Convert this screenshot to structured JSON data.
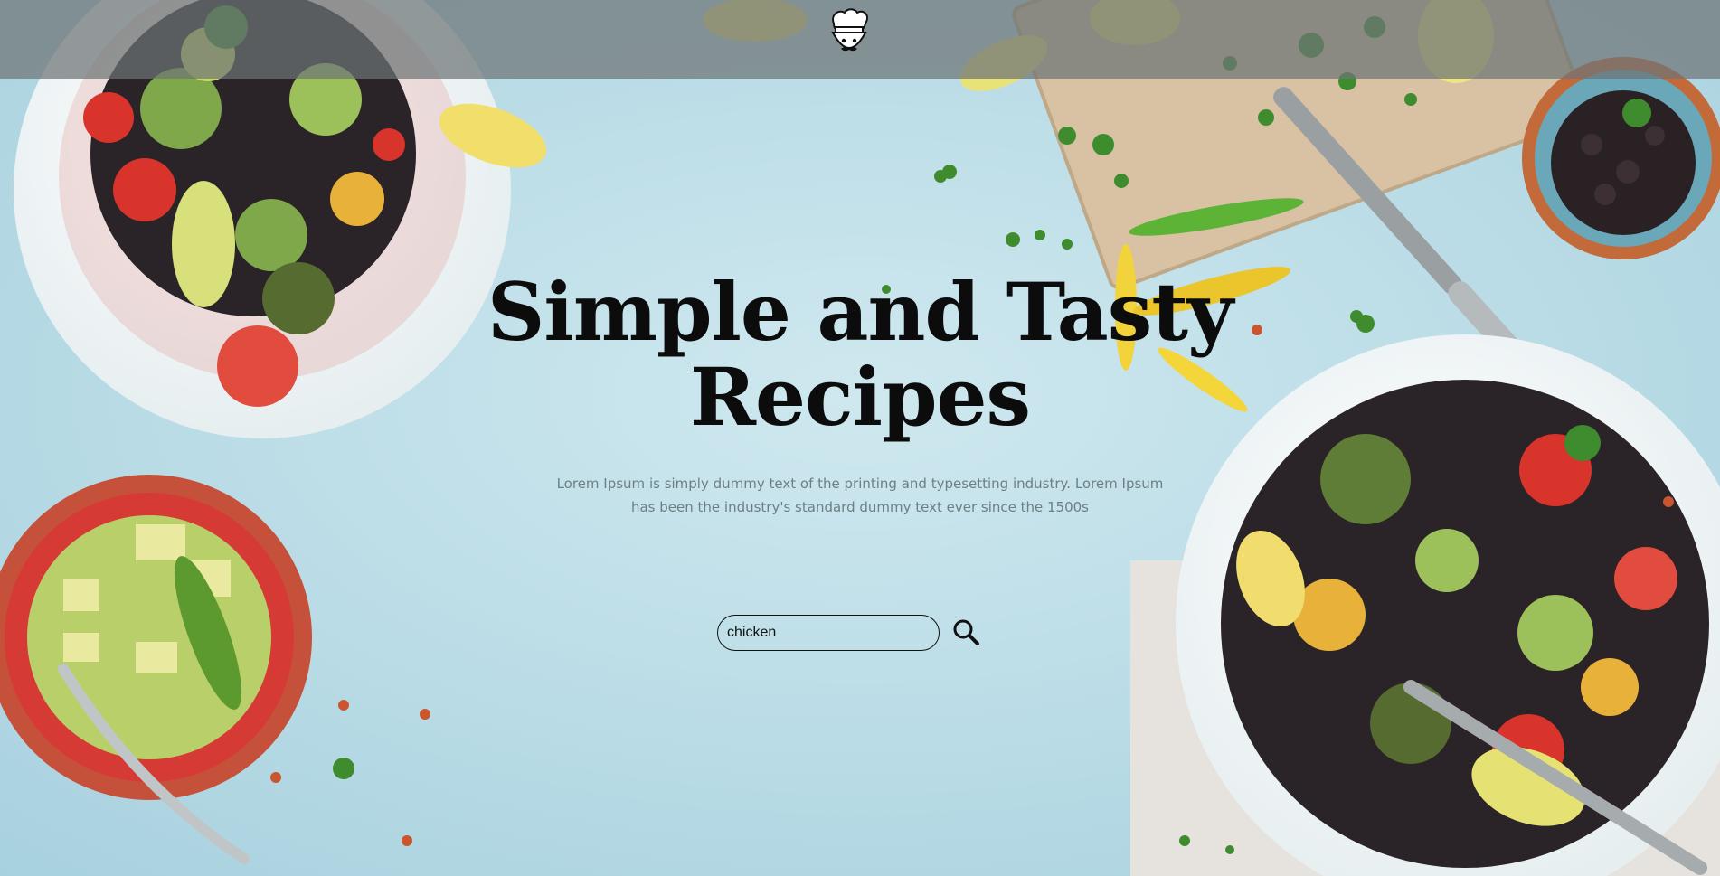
{
  "header": {
    "logo_icon": "chef-mustache-icon",
    "background": "#6e7476"
  },
  "hero": {
    "title_line1": "Simple and Tasty",
    "title_line2": "Recipes",
    "subtitle": "Lorem Ipsum is simply dummy text of the printing and typesetting industry. Lorem Ipsum has been the industry's standard dummy text ever since the 1500s"
  },
  "search": {
    "value": "chicken",
    "button_icon": "search-icon"
  },
  "background": {
    "surface_color": "#b9dce6",
    "image_content": "food-table-photo"
  }
}
